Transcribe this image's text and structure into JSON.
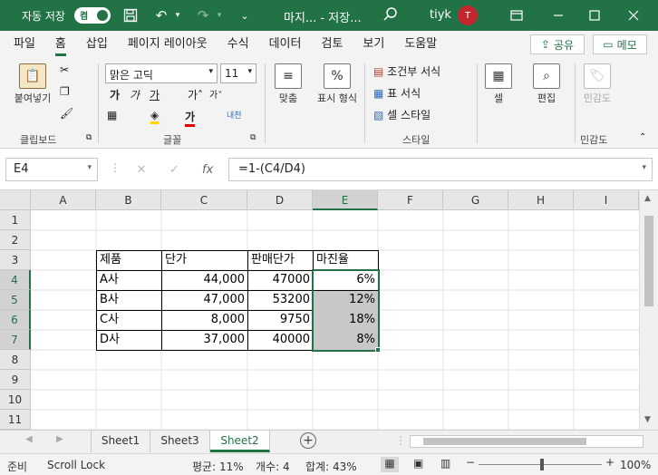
{
  "titlebar": {
    "autosave_label": "자동 저장",
    "autosave_toggle": "켬",
    "doc_title": "마지... - 저장...",
    "user_name": "tiyk",
    "avatar_initial": "T"
  },
  "menu": {
    "tabs": [
      "파일",
      "홈",
      "삽입",
      "페이지 레이아웃",
      "수식",
      "데이터",
      "검토",
      "보기",
      "도움말"
    ],
    "share_label": "공유",
    "memo_label": "메모"
  },
  "ribbon": {
    "paste_label": "붙여넣기",
    "clipboard_group": "클립보드",
    "font_name": "맑은 고딕",
    "font_size": "11",
    "font_group": "글꼴",
    "align_label": "맞춤",
    "number_label": "표시 형식",
    "cond_format": "조건부 서식",
    "table_format": "표 서식",
    "cell_style": "셀 스타일",
    "style_group": "스타일",
    "cells_label": "셀",
    "editing_label": "편집",
    "sensitivity_label": "민감도",
    "sensitivity_group": "민감도"
  },
  "formula_bar": {
    "name_box": "E4",
    "formula": "=1-(C4/D4)"
  },
  "grid": {
    "columns": [
      "A",
      "B",
      "C",
      "D",
      "E",
      "F",
      "G",
      "H",
      "I"
    ],
    "rows": [
      "1",
      "2",
      "3",
      "4",
      "5",
      "6",
      "7",
      "8",
      "9",
      "10",
      "11"
    ],
    "table_header": [
      "제품",
      "단가",
      "판매단가",
      "마진율"
    ],
    "table_rows": [
      [
        "A사",
        "44,000",
        "47000",
        "6%"
      ],
      [
        "B사",
        "47,000",
        "53200",
        "12%"
      ],
      [
        "C사",
        "8,000",
        "9750",
        "18%"
      ],
      [
        "D사",
        "37,000",
        "40000",
        "8%"
      ]
    ]
  },
  "sheets": {
    "tabs": [
      "Sheet1",
      "Sheet3",
      "Sheet2"
    ],
    "active": "Sheet2"
  },
  "status": {
    "ready": "준비",
    "scroll_lock": "Scroll Lock",
    "average": "평균: 11%",
    "count": "개수: 4",
    "sum": "합계: 43%",
    "zoom": "100%"
  },
  "colors": {
    "accent": "#217346",
    "avatar": "#c4262e"
  }
}
